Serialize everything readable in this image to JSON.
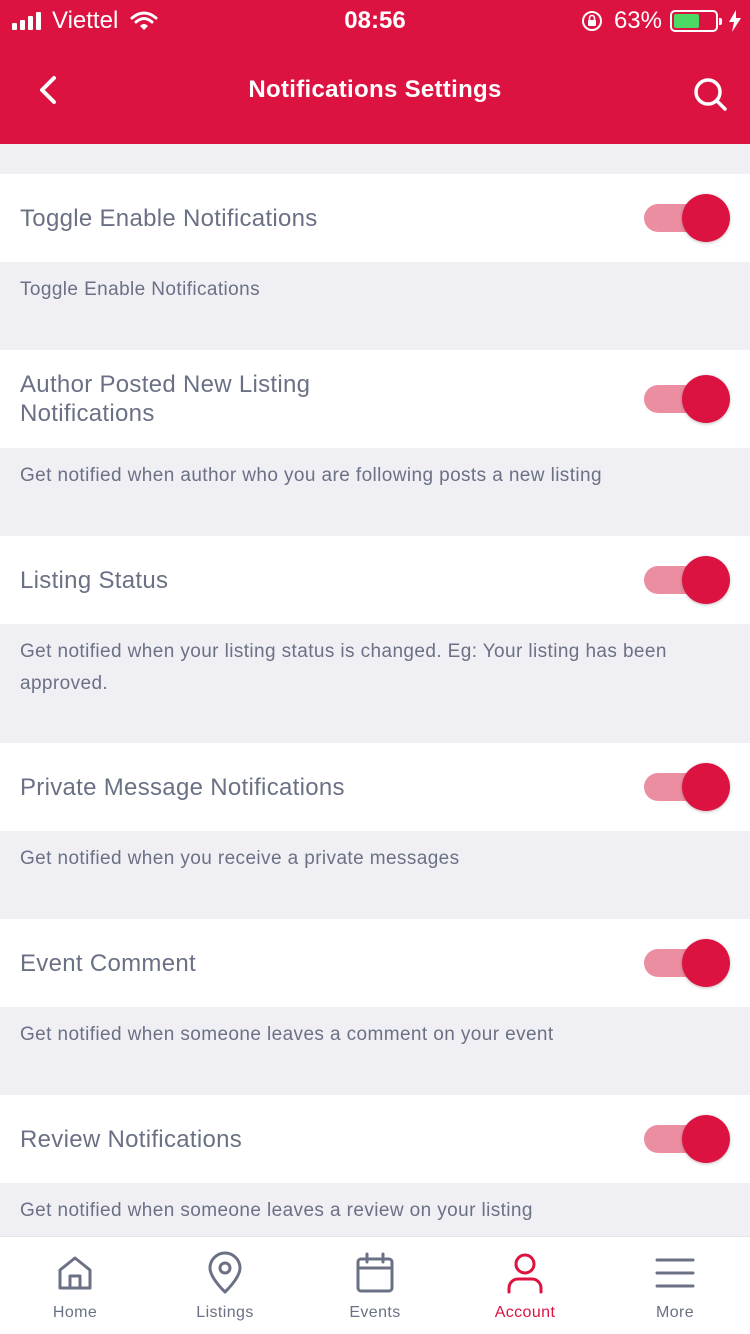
{
  "status_bar": {
    "carrier": "Viettel",
    "time": "08:56",
    "battery": "63%",
    "battery_level": 0.63
  },
  "nav": {
    "title": "Notifications Settings",
    "back_icon": "chevron-left-icon",
    "search_icon": "search-icon"
  },
  "settings": [
    {
      "title": "Toggle Enable Notifications",
      "description": "Toggle Enable Notifications",
      "enabled": true
    },
    {
      "title": "Author Posted New Listing Notifications",
      "description": "Get notified when author who you are following posts a new listing",
      "enabled": true
    },
    {
      "title": "Listing Status",
      "description": "Get notified when your listing status is changed. Eg: Your listing has been approved.",
      "enabled": true
    },
    {
      "title": "Private Message Notifications",
      "description": "Get notified when you receive a private messages",
      "enabled": true
    },
    {
      "title": "Event Comment",
      "description": "Get notified when someone leaves a comment on your event",
      "enabled": true
    },
    {
      "title": "Review Notifications",
      "description": "Get notified when someone leaves a review on your listing",
      "enabled": true
    }
  ],
  "tabs": [
    {
      "label": "Home",
      "icon": "home-icon"
    },
    {
      "label": "Listings",
      "icon": "location-pin-icon"
    },
    {
      "label": "Events",
      "icon": "calendar-icon"
    },
    {
      "label": "Account",
      "icon": "user-icon",
      "active": true
    },
    {
      "label": "More",
      "icon": "menu-icon"
    }
  ],
  "colors": {
    "brand": "#dc1340",
    "track": "#ec8ea2",
    "text": "#6b7185",
    "background": "#efeff4"
  }
}
